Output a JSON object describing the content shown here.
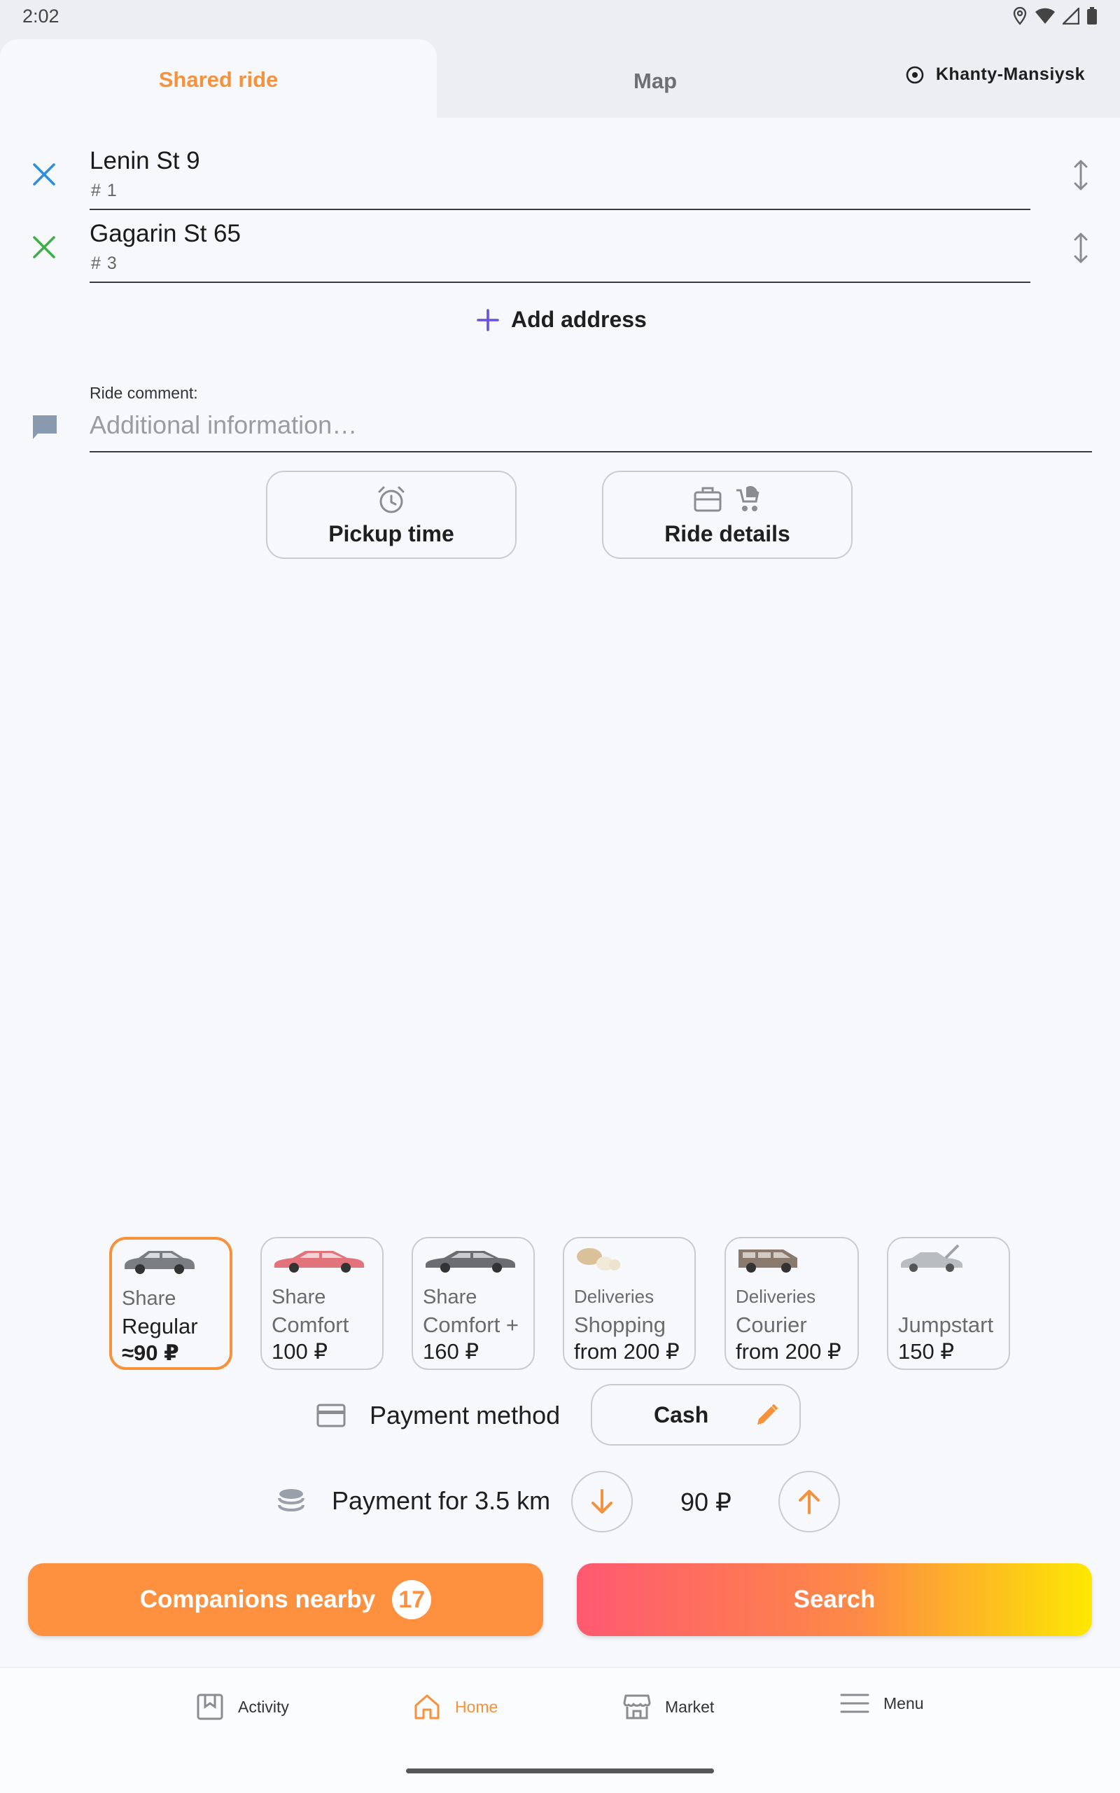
{
  "status_bar": {
    "time": "2:02"
  },
  "tabs": {
    "shared_ride": "Shared ride",
    "map": "Map",
    "city": "Khanty-Mansiysk"
  },
  "addresses": [
    {
      "street": "Lenin St 9",
      "number": "# 1",
      "color": "#2f8fdc"
    },
    {
      "street": "Gagarin St 65",
      "number": "# 3",
      "color": "#3fae4a"
    }
  ],
  "add_address": "Add address",
  "comment": {
    "label": "Ride comment:",
    "placeholder": "Additional information…",
    "value": ""
  },
  "buttons": {
    "pickup_time": "Pickup time",
    "ride_details": "Ride details"
  },
  "tariffs": [
    {
      "line1": "Share",
      "line2": "Regular",
      "line3": "≈90 ₽",
      "selected": true
    },
    {
      "line1": "Share",
      "line2": "Comfort",
      "line3": "100 ₽",
      "selected": false
    },
    {
      "line1": "Share",
      "line2": "Comfort +",
      "line3": "160 ₽",
      "selected": false
    },
    {
      "line1": "Deliveries",
      "line2": "Shopping",
      "line3": "from 200 ₽",
      "selected": false
    },
    {
      "line1": "Deliveries",
      "line2": "Courier",
      "line3": "from 200 ₽",
      "selected": false
    },
    {
      "line1": "",
      "line2": "Jumpstart",
      "line3": "150 ₽",
      "selected": false
    }
  ],
  "payment": {
    "method_label": "Payment method",
    "method_value": "Cash",
    "distance_label": "Payment for 3.5 km",
    "price": "90 ₽"
  },
  "actions": {
    "companions": "Companions nearby",
    "companions_count": "17",
    "search": "Search"
  },
  "nav": {
    "activity": "Activity",
    "home": "Home",
    "market": "Market",
    "menu": "Menu"
  },
  "colors": {
    "accent": "#f6913c",
    "search_gradient_start": "#fe5971",
    "search_gradient_end": "#fde802",
    "plus": "#6a4fe0"
  }
}
